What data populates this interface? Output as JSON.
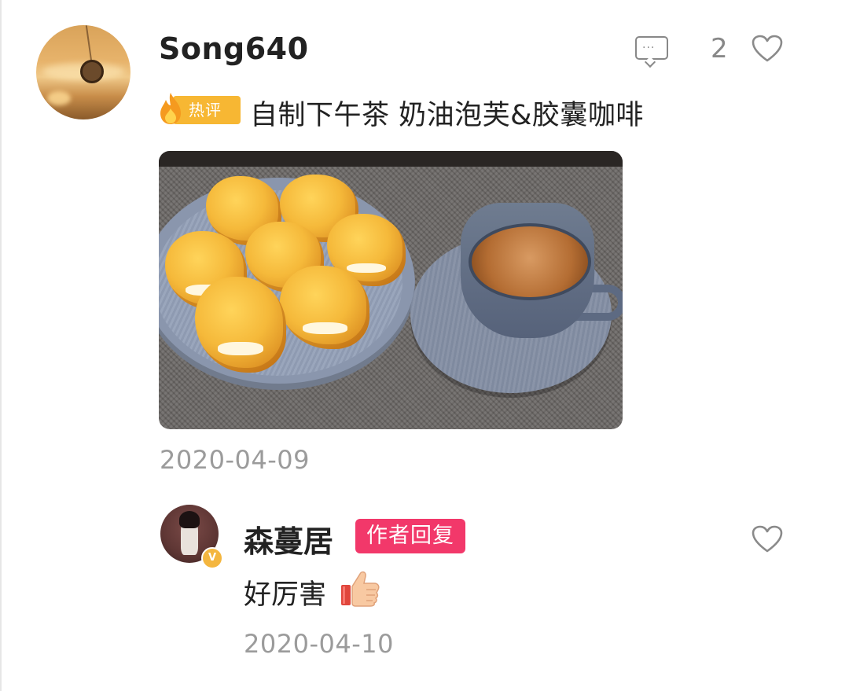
{
  "comment": {
    "username": "Song640",
    "like_count": "2",
    "hot_badge": "热评",
    "text": "自制下午茶 奶油泡芙&胶囊咖啡",
    "date": "2020-04-09",
    "image_alt": "cream puffs and capsule coffee on gray plates"
  },
  "reply": {
    "username": "森蔓居",
    "author_badge": "作者回复",
    "verified_mark": "V",
    "text": "好厉害",
    "emoji": "thumbs-up",
    "date": "2020-04-10"
  },
  "icons": {
    "message": "message-icon",
    "heart": "heart-icon",
    "flame": "flame-icon"
  },
  "colors": {
    "hot_badge": "#f7b733",
    "author_badge": "#f2386a",
    "secondary_text": "#9b9b9b",
    "primary_text": "#222222"
  }
}
